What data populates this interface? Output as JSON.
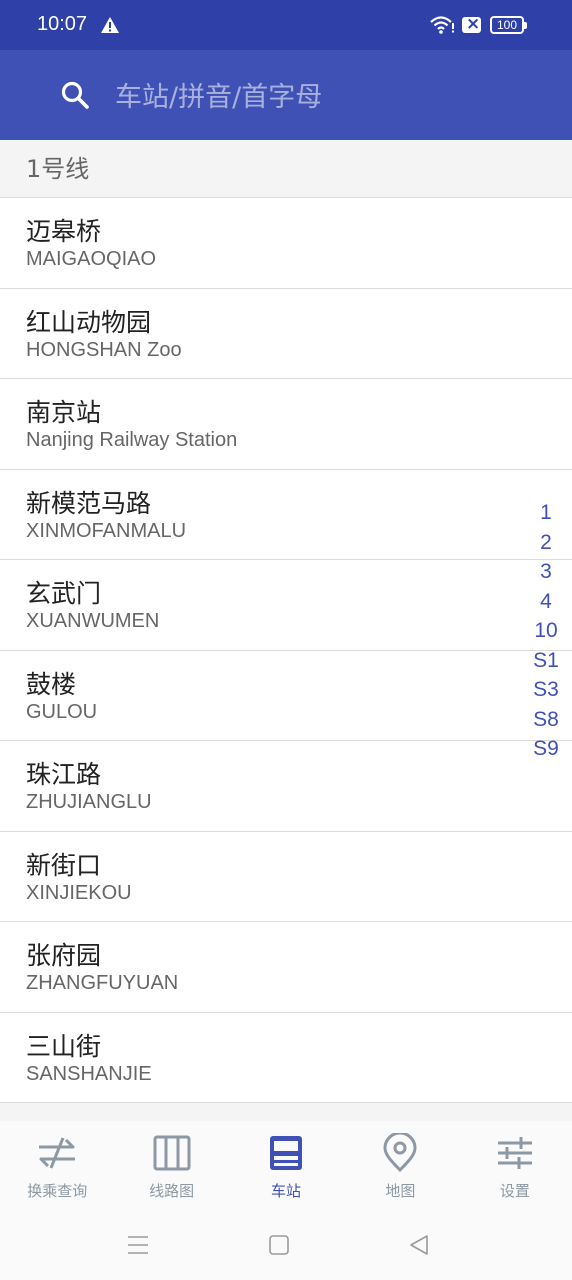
{
  "status": {
    "time": "10:07",
    "battery": "100"
  },
  "search": {
    "placeholder": "车站/拼音/首字母"
  },
  "section": {
    "title": "1号线"
  },
  "stations": [
    {
      "name": "迈皋桥",
      "en": "MAIGAOQIAO"
    },
    {
      "name": "红山动物园",
      "en": "HONGSHAN Zoo"
    },
    {
      "name": "南京站",
      "en": "Nanjing Railway Station"
    },
    {
      "name": "新模范马路",
      "en": "XINMOFANMALU"
    },
    {
      "name": "玄武门",
      "en": "XUANWUMEN"
    },
    {
      "name": "鼓楼",
      "en": "GULOU"
    },
    {
      "name": "珠江路",
      "en": "ZHUJIANGLU"
    },
    {
      "name": "新街口",
      "en": "XINJIEKOU"
    },
    {
      "name": "张府园",
      "en": "ZHANGFUYUAN"
    },
    {
      "name": "三山街",
      "en": "SANSHANJIE"
    }
  ],
  "index_bar": [
    "1",
    "2",
    "3",
    "4",
    "10",
    "S1",
    "S3",
    "S8",
    "S9"
  ],
  "nav": [
    {
      "label": "换乘查询",
      "icon": "transfer-icon"
    },
    {
      "label": "线路图",
      "icon": "map-book-icon"
    },
    {
      "label": "车站",
      "icon": "train-icon",
      "active": true
    },
    {
      "label": "地图",
      "icon": "location-pin-icon"
    },
    {
      "label": "设置",
      "icon": "settings-sliders-icon"
    }
  ],
  "colors": {
    "primary": "#3f51b5",
    "status_bar": "#2f40a8",
    "nav_inactive": "#8c98a4"
  }
}
